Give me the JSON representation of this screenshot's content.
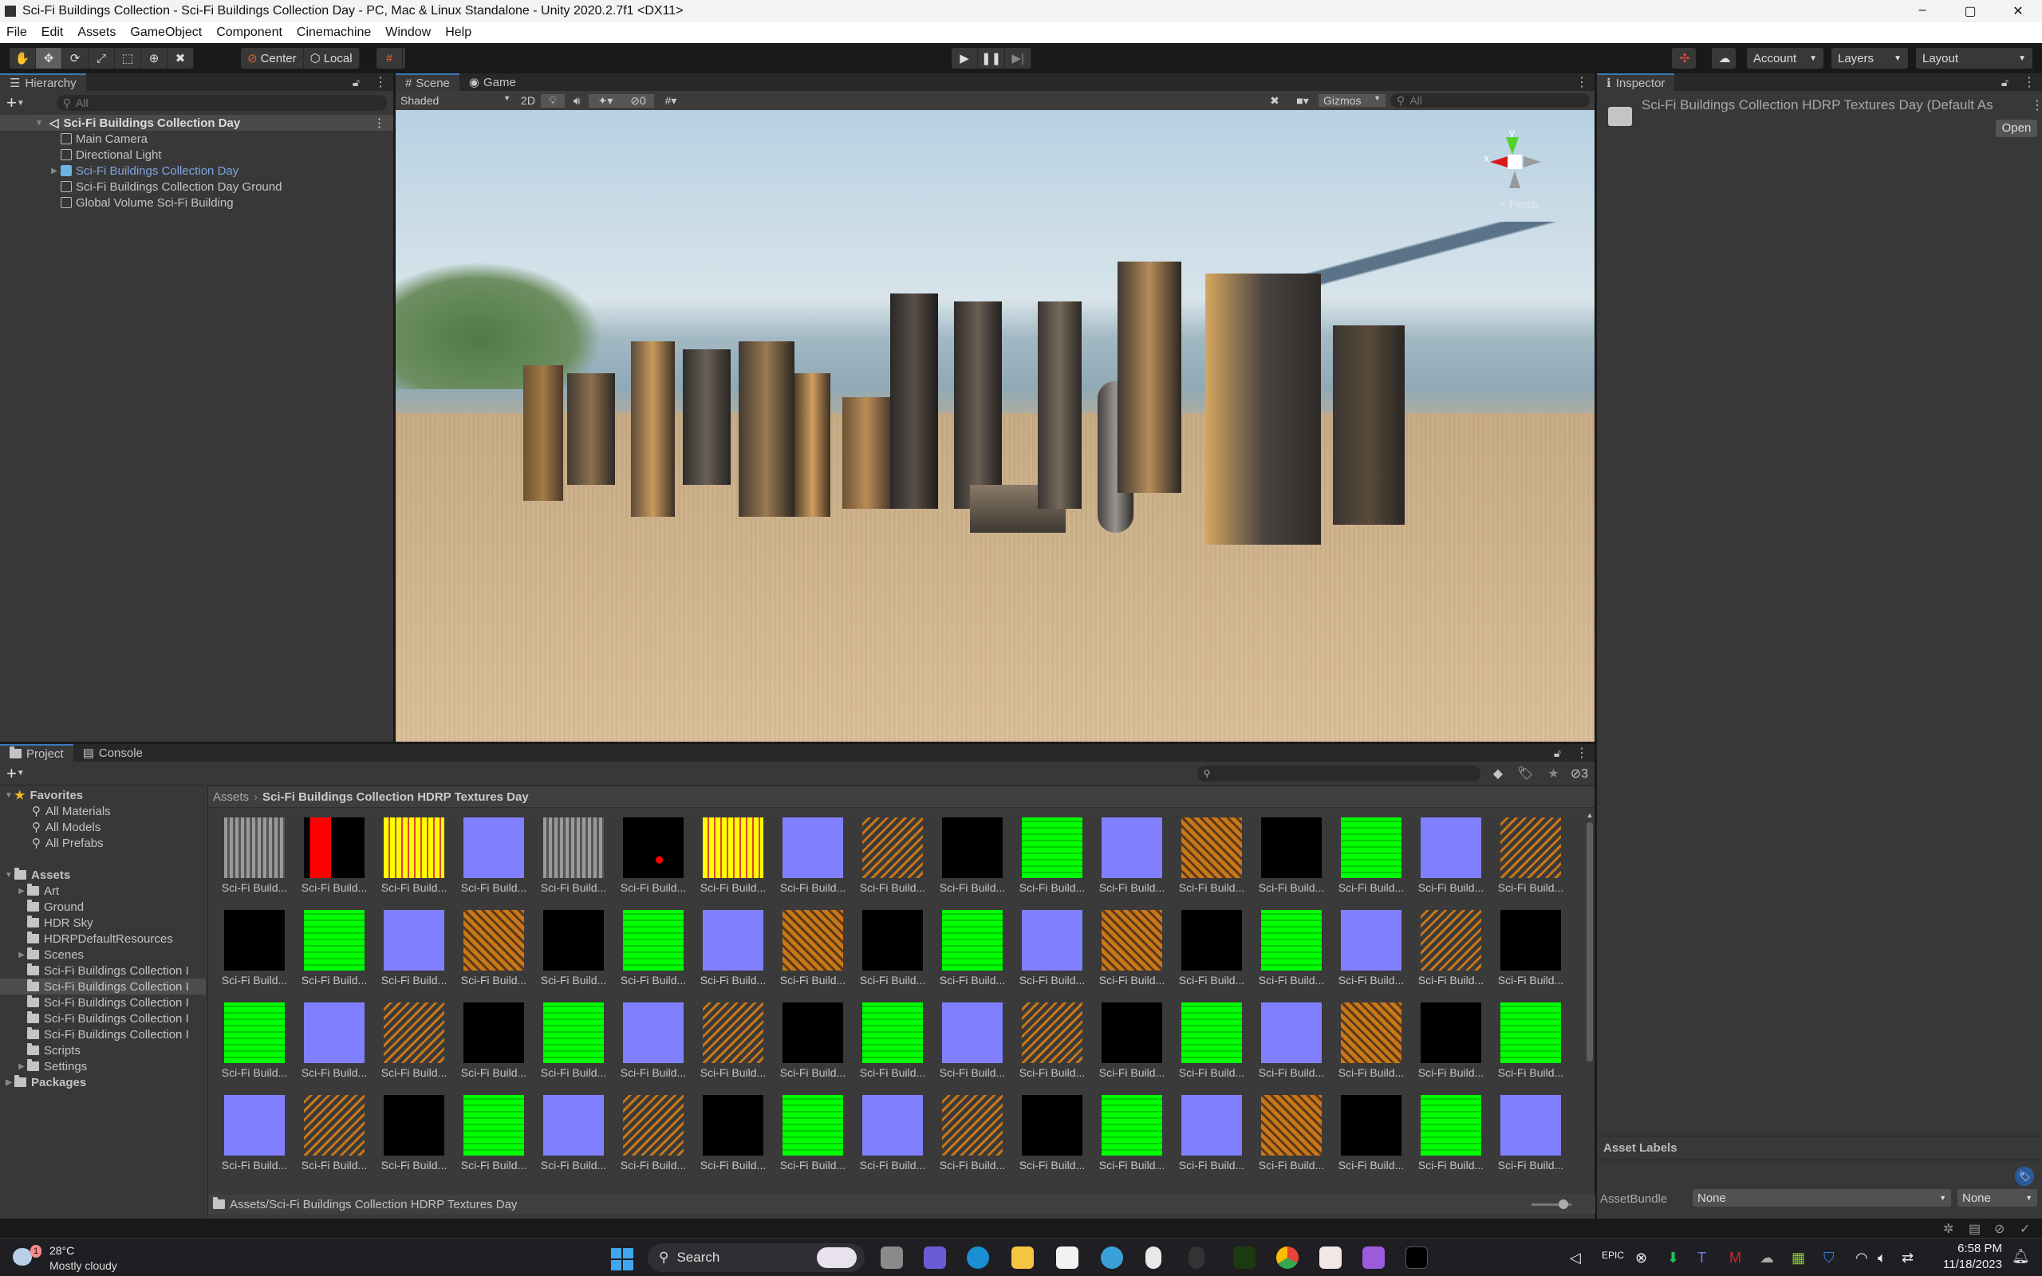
{
  "window": {
    "title": "Sci-Fi Buildings Collection - Sci-Fi Buildings Collection Day - PC, Mac & Linux Standalone - Unity 2020.2.7f1 <DX11>",
    "controls": {
      "minimize": "–",
      "maximize": "▢",
      "close": "✕"
    }
  },
  "menu": [
    "File",
    "Edit",
    "Assets",
    "GameObject",
    "Component",
    "Cinemachine",
    "Window",
    "Help"
  ],
  "toolbar": {
    "tools": [
      "hand-tool",
      "move-tool",
      "rotate-tool",
      "scale-tool",
      "rect-tool",
      "transform-tool",
      "custom-tool"
    ],
    "pivot_label": "Center",
    "space_label": "Local",
    "account_label": "Account",
    "layers_label": "Layers",
    "layout_label": "Layout"
  },
  "hierarchy": {
    "tab_label": "Hierarchy",
    "search_placeholder": "All",
    "scene_name": "Sci-Fi Buildings Collection Day",
    "items": [
      {
        "label": "Main Camera",
        "type": "gameobject"
      },
      {
        "label": "Directional Light",
        "type": "gameobject"
      },
      {
        "label": "Sci-Fi Buildings Collection Day",
        "type": "prefab"
      },
      {
        "label": "Sci-Fi Buildings Collection Day Ground",
        "type": "gameobject"
      },
      {
        "label": "Global Volume Sci-Fi Building",
        "type": "gameobject"
      }
    ]
  },
  "scene_view": {
    "tabs": [
      "Scene",
      "Game"
    ],
    "shading_mode": "Shaded",
    "mode_2d": "2D",
    "hidden_count": "0",
    "gizmos_label": "Gizmos",
    "search_placeholder": "All",
    "projection": "< Persp",
    "axis_x": "x",
    "axis_y": "y"
  },
  "inspector": {
    "tab_label": "Inspector",
    "asset_title": "Sci-Fi Buildings Collection HDRP Textures Day (Default As",
    "open_label": "Open",
    "asset_labels_title": "Asset Labels",
    "assetbundle_label": "AssetBundle",
    "assetbundle_value": "None",
    "assetbundle_variant": "None"
  },
  "project": {
    "tabs": [
      "Project",
      "Console"
    ],
    "hidden_count": "3",
    "favorites_label": "Favorites",
    "favorites": [
      "All Materials",
      "All Models",
      "All Prefabs"
    ],
    "assets_label": "Assets",
    "folders": [
      {
        "label": "Art",
        "expandable": true
      },
      {
        "label": "Ground",
        "expandable": false
      },
      {
        "label": "HDR Sky",
        "expandable": false
      },
      {
        "label": "HDRPDefaultResources",
        "expandable": false
      },
      {
        "label": "Scenes",
        "expandable": true
      },
      {
        "label": "Sci-Fi Buildings Collection I",
        "expandable": false
      },
      {
        "label": "Sci-Fi Buildings Collection I",
        "expandable": false,
        "selected": true
      },
      {
        "label": "Sci-Fi Buildings Collection I",
        "expandable": false
      },
      {
        "label": "Sci-Fi Buildings Collection I",
        "expandable": false
      },
      {
        "label": "Sci-Fi Buildings Collection I",
        "expandable": false
      },
      {
        "label": "Scripts",
        "expandable": false
      },
      {
        "label": "Settings",
        "expandable": true
      }
    ],
    "packages_label": "Packages",
    "breadcrumb_root": "Assets",
    "breadcrumb_current": "Sci-Fi Buildings Collection HDRP Textures Day",
    "item_label": "Sci-Fi Build...",
    "thumbnails": [
      [
        "gray",
        "redblack",
        "yellow",
        "blue",
        "gray",
        "blackred",
        "yellow",
        "blue",
        "darkorange",
        "black",
        "green",
        "blue",
        "orange",
        "black",
        "green",
        "blue",
        "darkorange"
      ],
      [
        "black",
        "green",
        "blue",
        "orange",
        "black",
        "green",
        "blue",
        "orange",
        "black",
        "green",
        "blue",
        "orange",
        "black",
        "green",
        "blue",
        "darkorange",
        "black"
      ],
      [
        "green",
        "blue",
        "darkorange",
        "black",
        "green",
        "blue",
        "darkorange",
        "black",
        "green",
        "blue",
        "darkorange",
        "black",
        "green",
        "blue",
        "orange",
        "black",
        "green"
      ],
      [
        "blue",
        "darkorange",
        "black",
        "green",
        "blue",
        "darkorange",
        "black",
        "green",
        "blue",
        "darkorange",
        "black",
        "green",
        "blue",
        "orange",
        "black",
        "green",
        "blue"
      ]
    ],
    "status_path": "Assets/Sci-Fi Buildings Collection HDRP Textures Day"
  },
  "taskbar": {
    "weather_temp": "28°C",
    "weather_desc": "Mostly cloudy",
    "weather_badge": "1",
    "search_label": "Search",
    "time": "6:58 PM",
    "date": "11/18/2023"
  },
  "colors": {
    "accent": "#3a79bb",
    "prefab_text": "#7ea6e0",
    "thumb_blue": "#8080ff",
    "thumb_green": "#0fe80f",
    "thumb_black": "#000000",
    "thumb_orange": "#c97718",
    "thumb_yellow": "#ffee00"
  }
}
